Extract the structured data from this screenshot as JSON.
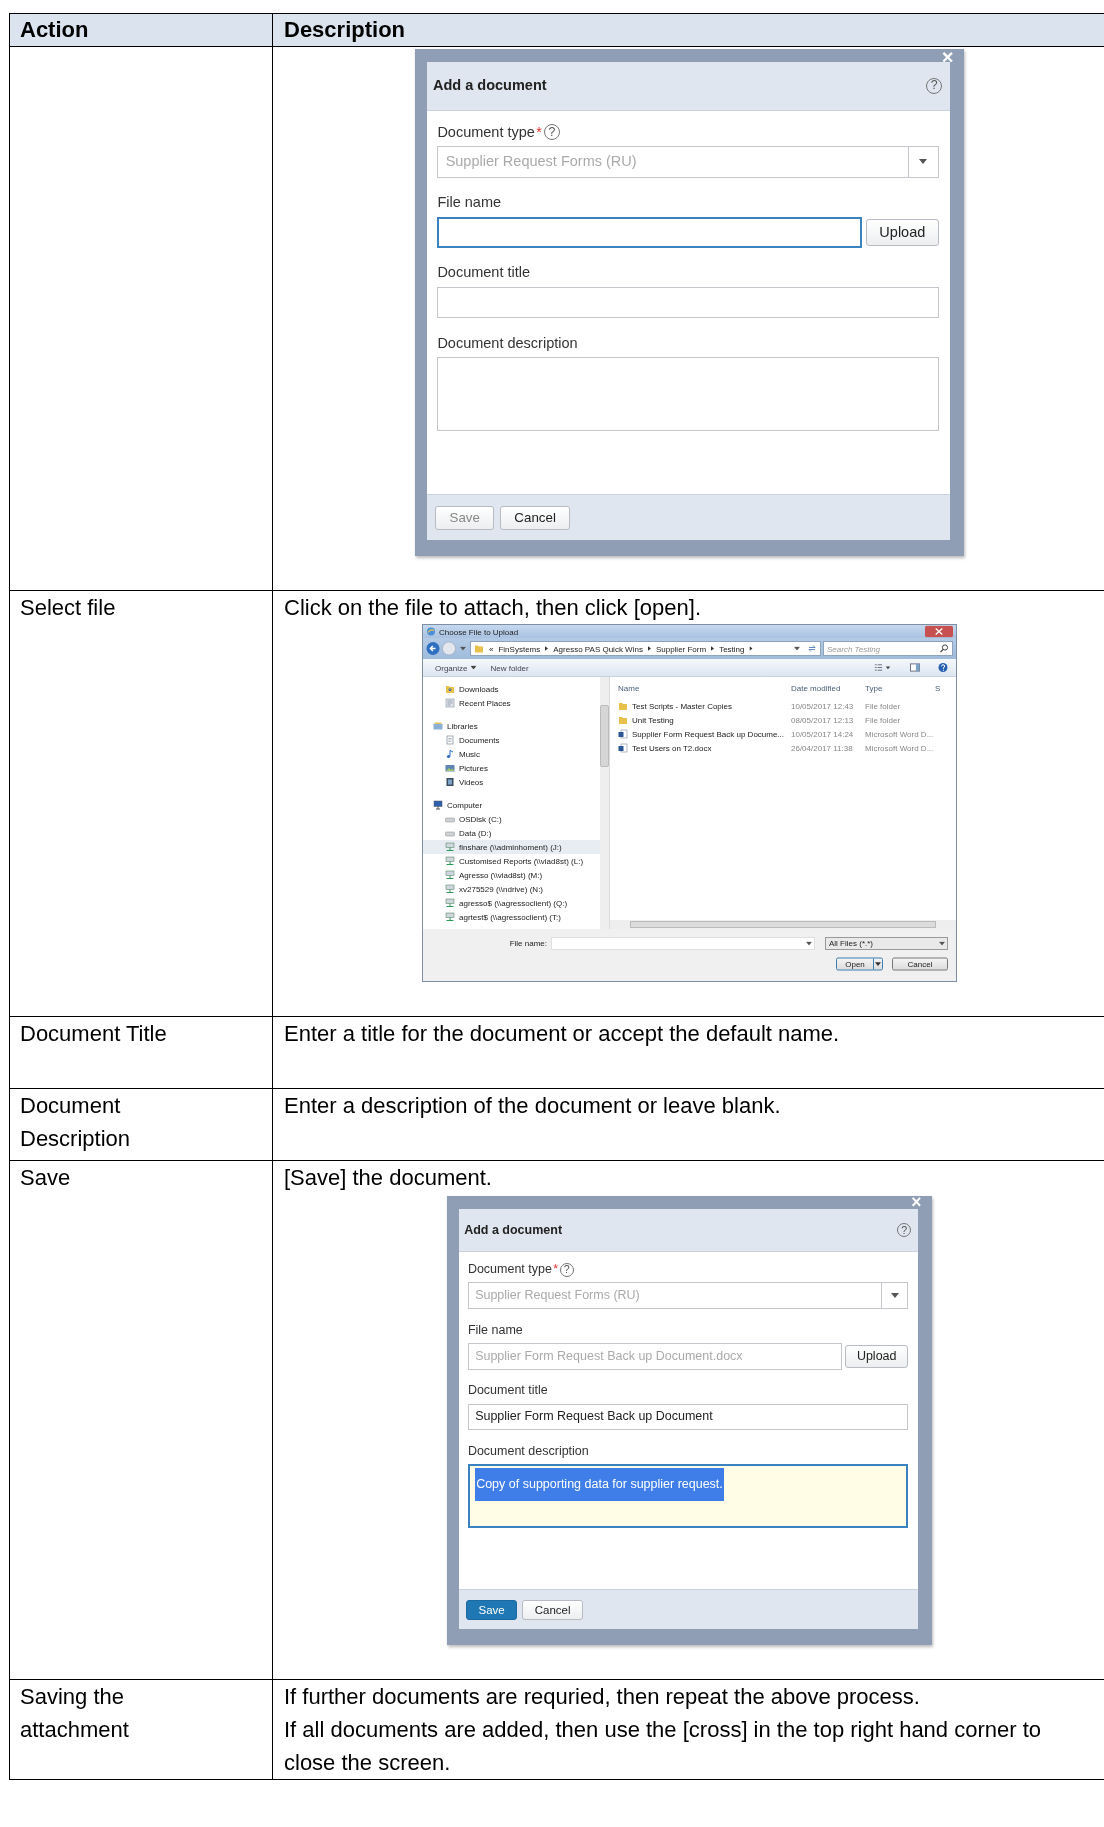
{
  "table": {
    "columns": [
      "Action",
      "Description"
    ],
    "rows": [
      {
        "figure": {
          "kind": "upload_dialog",
          "title": "Add a document",
          "close": "×",
          "help": "?",
          "fields": [
            {
              "kind": "select",
              "label": "Document type",
              "required_mark": "*",
              "help": "?",
              "value": "Supplier Request Forms (RU)",
              "disabled": true,
              "focused": false
            },
            {
              "kind": "upload",
              "label": "File name",
              "button": "Upload",
              "disabled": false,
              "focused": true
            },
            {
              "kind": "text",
              "label": "Document title",
              "focused": false
            },
            {
              "kind": "textarea",
              "label": "Document description",
              "focused": false
            }
          ],
          "buttons": [
            {
              "label": "Save",
              "primary": false,
              "disabled": true
            },
            {
              "label": "Cancel",
              "primary": false,
              "disabled": false
            }
          ]
        }
      },
      {
        "action": "Select file",
        "description": [
          "Click on the file to attach, then click [open]."
        ],
        "figure": {
          "kind": "file_dialog",
          "title": "Choose File to Upload",
          "path_overflow": "«",
          "path": [
            "FinSystems",
            "Agresso PAS Quick Wins",
            "Supplier Form",
            "Testing"
          ],
          "search": {
            "placeholder": "Search Testing"
          },
          "toolbar": [
            {
              "label": "Organize",
              "menu": true
            },
            {
              "label": "New folder",
              "menu": false
            }
          ],
          "nav": [
            {
              "kind": "downloads",
              "label": "Downloads",
              "selected": false
            },
            {
              "kind": "recent",
              "label": "Recent Places",
              "selected": false
            },
            {
              "kind": "library",
              "label": "Libraries",
              "selected": false,
              "children": [
                {
                  "kind": "document",
                  "label": "Documents",
                  "selected": false
                },
                {
                  "kind": "music",
                  "label": "Music",
                  "selected": false
                },
                {
                  "kind": "picture",
                  "label": "Pictures",
                  "selected": false
                },
                {
                  "kind": "video",
                  "label": "Videos",
                  "selected": false
                }
              ]
            },
            {
              "kind": "computer",
              "label": "Computer",
              "selected": false,
              "children": [
                {
                  "kind": "disk",
                  "label": "OSDisk (C:)",
                  "selected": false
                },
                {
                  "kind": "disk",
                  "label": "Data (D:)",
                  "selected": false
                },
                {
                  "kind": "network",
                  "label": "finshare (\\\\adminhoment) (J:)",
                  "selected": true
                },
                {
                  "kind": "network",
                  "label": "Customised Reports (\\\\viad8st) (L:)",
                  "selected": false
                },
                {
                  "kind": "network",
                  "label": "Agresso (\\\\viad8st) (M:)",
                  "selected": false
                },
                {
                  "kind": "network",
                  "label": "xv275529 (\\\\ndrive) (N:)",
                  "selected": false
                },
                {
                  "kind": "network",
                  "label": "agresso$ (\\\\agressoclient) (Q:)",
                  "selected": false
                },
                {
                  "kind": "network",
                  "label": "agrtest$ (\\\\agressoclient) (T:)",
                  "selected": false
                }
              ]
            }
          ],
          "columns": [
            "Name",
            "Date modified",
            "Type",
            "S"
          ],
          "files": [
            {
              "kind": "folder",
              "name": "Test Scripts - Master Copies",
              "date": "10/05/2017 12:43",
              "type": "File folder"
            },
            {
              "kind": "folder",
              "name": "Unit Testing",
              "date": "08/05/2017 12:13",
              "type": "File folder"
            },
            {
              "kind": "word",
              "name": "Supplier Form Request Back up Docume...",
              "date": "10/05/2017 14:24",
              "type": "Microsoft Word D..."
            },
            {
              "kind": "word",
              "name": "Test Users on T2.docx",
              "date": "26/04/2017 11:38",
              "type": "Microsoft Word D..."
            }
          ],
          "file_name": {
            "label": "File name:"
          },
          "filter": "All Files (*.*)",
          "buttons": [
            {
              "label": "Open",
              "split": true
            },
            {
              "label": "Cancel",
              "split": false
            }
          ]
        }
      },
      {
        "action": "Document Title",
        "description": [
          "Enter a title for the document or accept the default name."
        ]
      },
      {
        "action": "Document Description",
        "description": [
          "Enter a description of the document or leave blank."
        ]
      },
      {
        "action": "Save",
        "description": [
          "[Save] the document."
        ],
        "figure": {
          "kind": "upload_dialog",
          "title": "Add a document",
          "close": "×",
          "help": "?",
          "fields": [
            {
              "kind": "select",
              "label": "Document type",
              "required_mark": "*",
              "help": "?",
              "value": "Supplier Request Forms (RU)",
              "disabled": true,
              "focused": false
            },
            {
              "kind": "upload",
              "label": "File name",
              "value": "Supplier Form Request Back up Document.docx",
              "button": "Upload",
              "disabled": true,
              "focused": false
            },
            {
              "kind": "text",
              "label": "Document title",
              "value": "Supplier Form Request Back up Document",
              "disabled": false,
              "focused": false
            },
            {
              "kind": "textarea",
              "label": "Document description",
              "value": "Copy of supporting data for supplier request.",
              "disabled": false,
              "focused": true,
              "text_selected": true
            }
          ],
          "buttons": [
            {
              "label": "Save",
              "primary": true,
              "disabled": false
            },
            {
              "label": "Cancel",
              "primary": false,
              "disabled": false
            }
          ]
        }
      },
      {
        "action": "Saving the attachment",
        "description": [
          "If further documents are requried, then repeat the above process.",
          "If all documents are added, then use the [cross] in the top right hand corner to close the screen."
        ]
      }
    ]
  }
}
